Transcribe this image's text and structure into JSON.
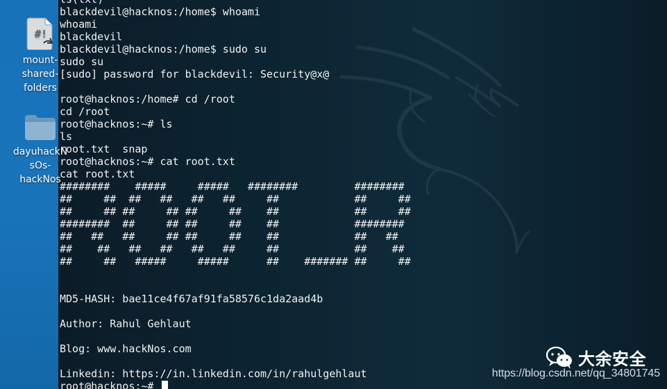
{
  "desktop": {
    "icons": [
      {
        "kind": "script-file",
        "label_lines": [
          "mount-",
          "shared-",
          "folders"
        ]
      },
      {
        "kind": "folder",
        "label_lines": [
          "dayuhackN",
          "sOs-",
          "hackNos"
        ]
      }
    ]
  },
  "terminal": {
    "lines": [
      "ls(txt)",
      "blackdevil@hacknos:/home$ whoami",
      "whoami",
      "blackdevil",
      "blackdevil@hacknos:/home$ sudo su",
      "sudo su",
      "[sudo] password for blackdevil: Security@x@",
      "",
      "root@hacknos:/home# cd /root",
      "cd /root",
      "root@hacknos:~# ls",
      "ls",
      "root.txt  snap",
      "root@hacknos:~# cat root.txt",
      "cat root.txt",
      "########    #####     #####   ########         ########",
      "##     ##  ##   ##   ##   ##     ##            ##     ##",
      "##     ## ##     ## ##     ##    ##            ##     ##",
      "########  ##     ## ##     ##    ##            ########",
      "##   ##   ##     ## ##     ##    ##            ##   ##",
      "##    ##   ##   ##   ##   ##     ##            ##    ##",
      "##     ##   #####     #####      ##    ####### ##     ##",
      "",
      "",
      "MD5-HASH: bae11ce4f67af91fa58576c1da2aad4b",
      "",
      "Author: Rahul Gehlaut",
      "",
      "Blog: www.hackNos.com",
      "",
      "Linkedin: https://in.linkedin.com/in/rahulgehlaut"
    ],
    "prompt": "root@hacknos:~# "
  },
  "watermark": {
    "name": "大余安全",
    "url": "https://blog.csdn.net/qq_34801745",
    "icon": "wechat-icon"
  },
  "colors": {
    "terminal_text": "#f2f2f2",
    "desktop_blue": "#1872ba",
    "terminal_background": "#0d2634"
  }
}
